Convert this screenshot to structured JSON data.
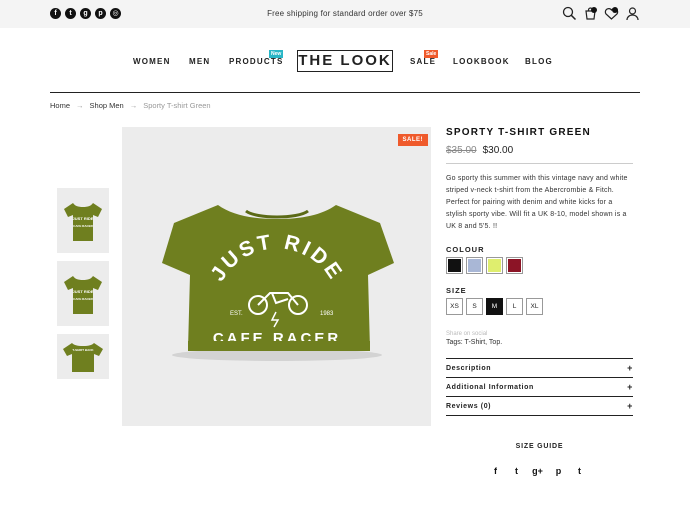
{
  "topbar": {
    "social": [
      {
        "glyph": "f",
        "icon": "facebook-icon"
      },
      {
        "glyph": "t",
        "icon": "twitter-icon"
      },
      {
        "glyph": "g",
        "icon": "google-plus-icon"
      },
      {
        "glyph": "p",
        "icon": "pinterest-icon"
      },
      {
        "glyph": "◎",
        "icon": "instagram-icon"
      }
    ],
    "shipping": "Free shipping for standard order over $75"
  },
  "nav": {
    "women": "WOMEN",
    "men": "MEN",
    "products": "PRODUCTS",
    "products_badge": "New",
    "logo": "THE LOOK",
    "sale": "SALE",
    "sale_badge": "Sale",
    "lookbook": "LOOKBOOK",
    "blog": "BLOG",
    "colors": {
      "new": "#29b6c6",
      "sale": "#ef5a2b"
    }
  },
  "breadcrumb": {
    "home": "Home",
    "shop": "Shop Men",
    "current": "Sporty T-shirt Green"
  },
  "product": {
    "image_text": {
      "line1": "JUST RIDE",
      "est": "EST.",
      "year": "1983",
      "line3": "CAFE RACER"
    },
    "thumb_labels": [
      "JUST RIDE",
      "CAFE RACER",
      "T-SHIRT BACK"
    ],
    "sale_badge": "SALE!",
    "title": "SPORTY T-SHIRT GREEN",
    "old_price": "$35.00",
    "price": "$30.00",
    "description": "Go sporty this summer with this vintage navy and white striped v-neck t-shirt from the Abercrombie & Fitch. Perfect for pairing with denim and white kicks for a stylish sporty vibe. Will fit a UK 8-10, model shown is a UK 8 and 5'5. !!",
    "colour_label": "COLOUR",
    "colours": [
      "#111111",
      "#a9b7d6",
      "#dfee6e",
      "#8c1426"
    ],
    "size_label": "SIZE",
    "sizes": [
      "XS",
      "S",
      "M",
      "L",
      "XL"
    ],
    "selected_size": "M",
    "faded_text": "Share on social",
    "tags": "Tags: T-Shirt, Top.",
    "accordion": [
      {
        "label": "Description",
        "icon": "+"
      },
      {
        "label": "Additional Information",
        "icon": "+"
      },
      {
        "label": "Reviews (0)",
        "icon": "+"
      }
    ],
    "size_guide": "SIZE GUIDE",
    "share": [
      {
        "glyph": "f",
        "icon": "facebook-icon"
      },
      {
        "glyph": "t",
        "icon": "twitter-icon"
      },
      {
        "glyph": "g+",
        "icon": "google-plus-icon"
      },
      {
        "glyph": "p",
        "icon": "pinterest-icon"
      },
      {
        "glyph": "t",
        "icon": "tumblr-icon"
      }
    ],
    "shirt_color": "#6f7f1f"
  }
}
